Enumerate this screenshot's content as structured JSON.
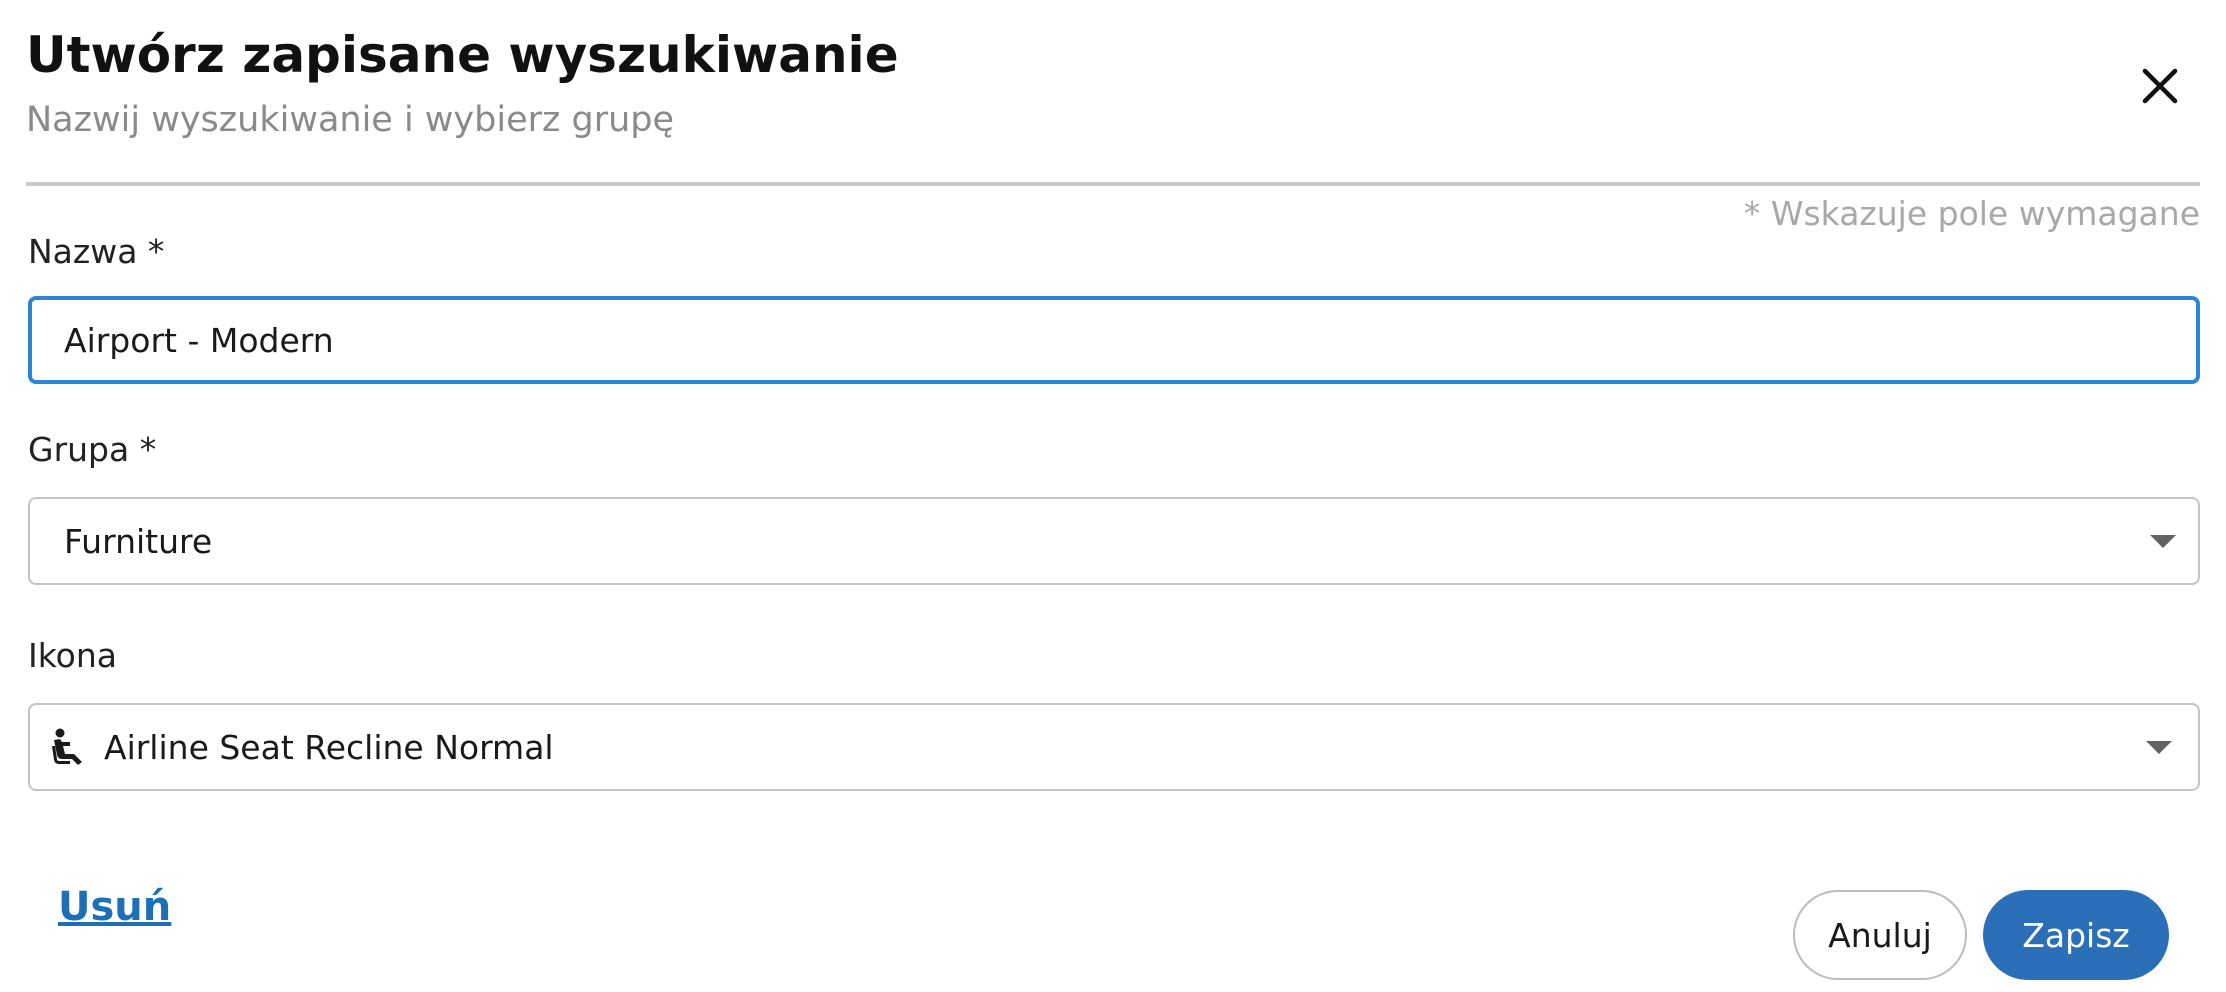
{
  "dialog": {
    "title": "Utwórz zapisane wyszukiwanie",
    "subtitle": "Nazwij wyszukiwanie i wybierz grupę",
    "close_icon": "close-icon",
    "required_note": "* Wskazuje pole wymagane"
  },
  "form": {
    "name": {
      "label": "Nazwa *",
      "value": "Airport - Modern"
    },
    "group": {
      "label": "Grupa *",
      "selected": "Furniture",
      "arrow_icon": "dropdown-arrow-icon"
    },
    "icon": {
      "label": "Ikona",
      "selected": "Airline Seat Recline Normal",
      "selected_icon": "airline-seat-recline-normal-icon",
      "arrow_icon": "dropdown-arrow-icon"
    }
  },
  "actions": {
    "delete_label": "Usuń",
    "cancel_label": "Anuluj",
    "save_label": "Zapisz"
  },
  "colors": {
    "accent": "#2a6fb7",
    "focus_border": "#2b87d6",
    "link": "#1f6fb8",
    "muted_text": "#8a8a8a"
  }
}
